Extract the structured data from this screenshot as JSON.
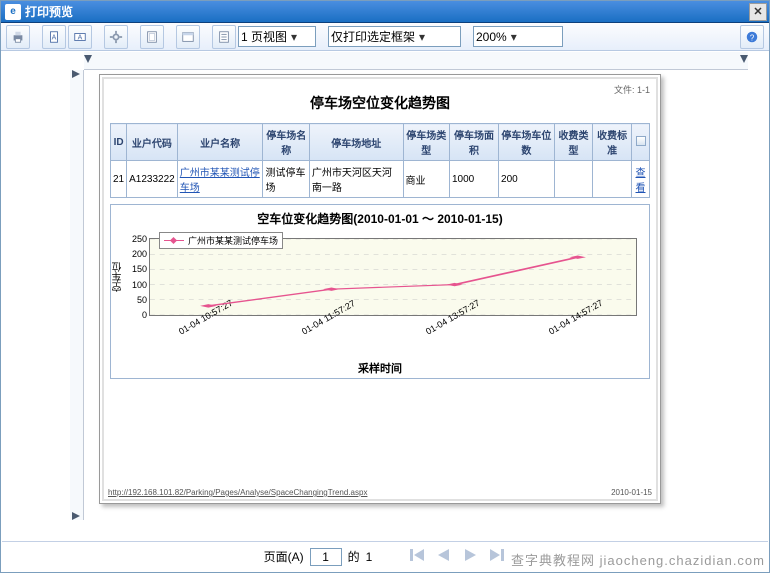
{
  "window": {
    "title": "打印预览",
    "icon_label": "e",
    "attach_label": "文件: 1-1"
  },
  "toolbar": {
    "print_icon": "printer-icon",
    "portrait_icon": "portrait-icon",
    "landscape_icon": "landscape-icon",
    "settings_icon": "gear-icon",
    "page_setup_icon": "page-icon",
    "header_icon": "header-icon",
    "fit_icon": "fit-icon",
    "view_select": "1 页视图",
    "scope_select": "仅打印选定框架",
    "zoom_select": "200%"
  },
  "page": {
    "title": "停车场空位变化趋势图",
    "table": {
      "headers": [
        "ID",
        "业户代码",
        "业户名称",
        "停车场名称",
        "停车场地址",
        "停车场类型",
        "停车场面积",
        "停车场车位数",
        "收费类型",
        "收费标准",
        ""
      ],
      "row": {
        "id": "21",
        "code": "A1233222",
        "name": "广州市某某测试停车场",
        "pname": "测试停车场",
        "addr": "广州市天河区天河南一路",
        "type": "商业",
        "area": "1000",
        "slots": "200",
        "feetype": "",
        "feestd": "",
        "view": "查看"
      }
    },
    "footer_url": "http://192.168.101.82/Parking/Pages/Analyse/SpaceChangingTrend.aspx",
    "footer_date": "2010-01-15"
  },
  "chart_data": {
    "type": "line",
    "title": "空车位变化趋势图(2010-01-01 ～ 2010-01-15)",
    "xlabel": "采样时间",
    "ylabel": "空车位",
    "ylim": [
      0,
      250
    ],
    "yticks": [
      0,
      50,
      100,
      150,
      200,
      250
    ],
    "categories": [
      "01-04 10:57:27",
      "01-04 11:57:27",
      "01-04 13:57:27",
      "01-04 14:57:27"
    ],
    "series": [
      {
        "name": "广州市某某测试停车场",
        "values": [
          30,
          85,
          100,
          190
        ],
        "color": "#e6548f"
      }
    ]
  },
  "nav": {
    "page_label": "页面(A)",
    "page_value": "1",
    "of_label": "的",
    "total": "1"
  },
  "watermark": "查字典教程网 jiaocheng.chazidian.com"
}
